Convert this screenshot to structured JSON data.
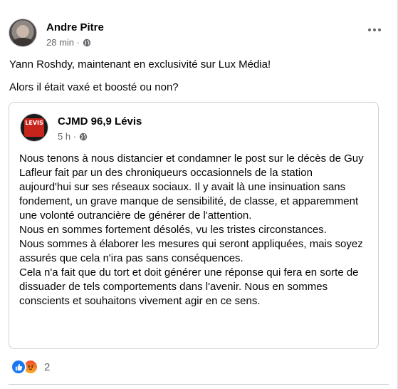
{
  "post": {
    "author": "Andre Pitre",
    "time": "28 min ·",
    "text": [
      "Yann Roshdy, maintenant en exclusivité sur Lux Média!",
      "Alors il était vaxé et boosté ou non?"
    ]
  },
  "shared": {
    "page_name": "CJMD 96,9 Lévis",
    "time": "5 h ·",
    "avatar_text": "LEVIS",
    "paragraphs": [
      "Nous tenons à nous distancier et condamner le post sur le décès de Guy Lafleur fait par un des chroniqueurs occasionnels de la station aujourd'hui sur ses réseaux sociaux. Il y avait là une insinuation sans fondement, un grave manque de sensibilité, de classe, et apparemment une volonté outrancière de générer de l'attention.",
      "Nous en sommes fortement désolés, vu les tristes circonstances.",
      "Nous sommes à élaborer les mesures qui seront appliquées, mais soyez assurés que cela n'ira pas sans conséquences.",
      "Cela n'a fait que du tort et doit générer une réponse qui fera en sorte de dissuader de tels comportements dans l'avenir. Nous en sommes conscients et souhaitons vivement agir en ce sens."
    ]
  },
  "reactions": {
    "count": "2",
    "types": [
      "like-icon",
      "angry-icon"
    ]
  },
  "colors": {
    "like": "#1877f2",
    "muted": "#65676b",
    "border": "#ced0d4"
  }
}
